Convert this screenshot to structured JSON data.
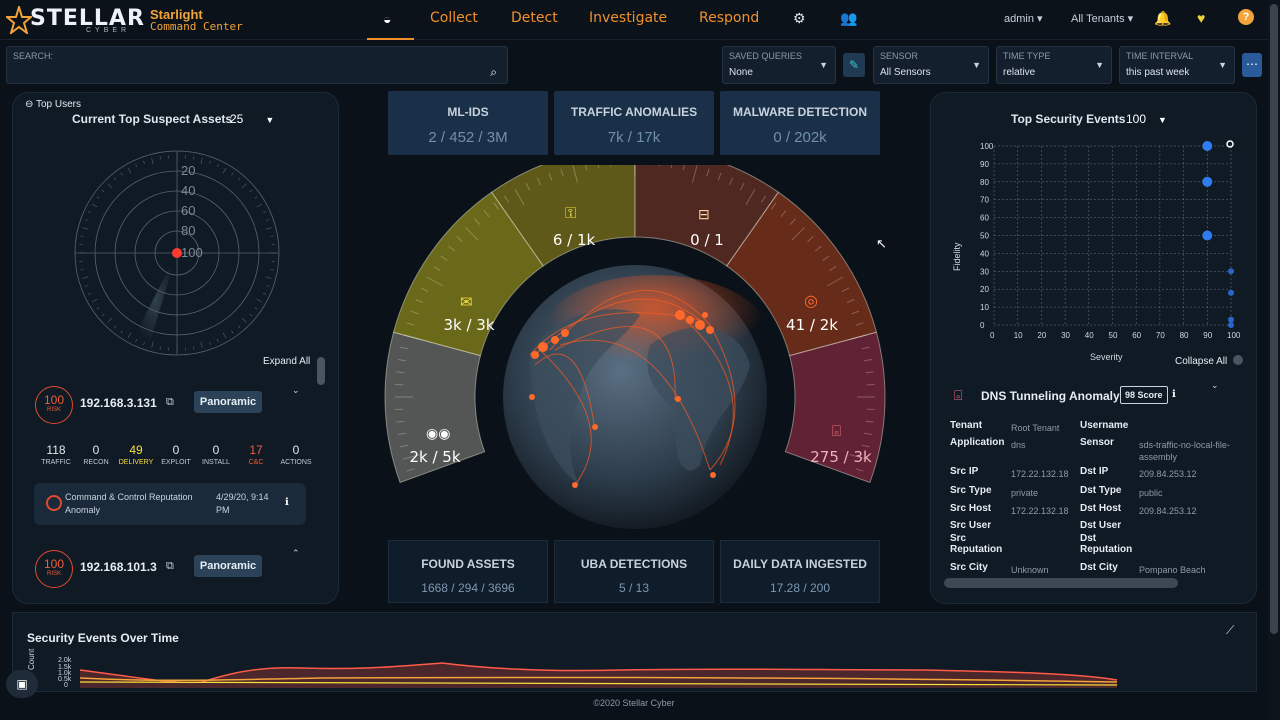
{
  "header": {
    "logo_word": "STELLAR",
    "logo_sub": "CYBER",
    "brand_line1": "Starlight",
    "brand_line2": "Command Center",
    "nav": [
      "Collect",
      "Detect",
      "Investigate",
      "Respond"
    ],
    "user": "admin ▾",
    "tenants": "All Tenants ▾"
  },
  "filters": {
    "search_label": "SEARCH:",
    "saved_queries": {
      "label": "SAVED QUERIES",
      "value": "None"
    },
    "sensor": {
      "label": "SENSOR",
      "value": "All Sensors"
    },
    "time_type": {
      "label": "TIME TYPE",
      "value": "relative"
    },
    "time_interval": {
      "label": "TIME INTERVAL",
      "value": "this past week"
    }
  },
  "left": {
    "top_users": "⊖ Top Users",
    "title": "Current Top Suspect Assets",
    "count": "25",
    "radar_labels": [
      "20",
      "40",
      "60",
      "80",
      "100"
    ],
    "expand_all": "Expand All",
    "assets": [
      {
        "risk": "100",
        "risk_label": "RISK",
        "ip": "192.168.3.131",
        "button": "Panoramic"
      },
      {
        "risk": "100",
        "risk_label": "RISK",
        "ip": "192.168.101.3",
        "button": "Panoramic"
      }
    ],
    "kill_chain": [
      {
        "n": "118",
        "l": "TRAFFIC"
      },
      {
        "n": "0",
        "l": "RECON"
      },
      {
        "n": "49",
        "l": "DELIVERY"
      },
      {
        "n": "0",
        "l": "EXPLOIT"
      },
      {
        "n": "0",
        "l": "INSTALL"
      },
      {
        "n": "17",
        "l": "C&C"
      },
      {
        "n": "0",
        "l": "ACTIONS"
      }
    ],
    "alert": {
      "text": "Command & Control Reputation Anomaly",
      "time": "4/29/20, 9:14 PM"
    }
  },
  "center": {
    "top_stats": [
      {
        "t": "ML-IDS",
        "v": "2 / 452 / 3M"
      },
      {
        "t": "TRAFFIC ANOMALIES",
        "v": "7k / 17k"
      },
      {
        "t": "MALWARE DETECTION",
        "v": "0 / 202k"
      }
    ],
    "gauge": [
      "2k / 5k",
      "3k / 3k",
      "6 / 1k",
      "0 / 1",
      "41 / 2k",
      "275 / 3k"
    ],
    "bottom_stats": [
      {
        "t": "FOUND ASSETS",
        "v": "1668 / 294 / 3696"
      },
      {
        "t": "UBA DETECTIONS",
        "v": "5 / 13"
      },
      {
        "t": "DAILY DATA INGESTED",
        "v": "17.28 / 200"
      }
    ]
  },
  "right": {
    "title": "Top Security Events",
    "count": "100",
    "y_label": "Fidelity",
    "x_label": "Severity",
    "collapse_all": "Collapse All",
    "event_title": "DNS Tunneling Anomaly",
    "score": "98 Score",
    "details": [
      {
        "k": "Tenant",
        "v": "Root Tenant",
        "k2": "Username",
        "v2": ""
      },
      {
        "k": "Application",
        "v": "dns",
        "k2": "Sensor",
        "v2": "sds-traffic-no-local-file-assembly"
      },
      {
        "k": "Src IP",
        "v": "172.22.132.18",
        "k2": "Dst IP",
        "v2": "209.84.253.12"
      },
      {
        "k": "Src Type",
        "v": "private",
        "k2": "Dst Type",
        "v2": "public"
      },
      {
        "k": "Src Host",
        "v": "172.22.132.18",
        "k2": "Dst Host",
        "v2": "209.84.253.12"
      },
      {
        "k": "Src User",
        "v": "",
        "k2": "Dst User",
        "v2": ""
      },
      {
        "k": "Src Reputation",
        "v": "",
        "k2": "Dst Reputation",
        "v2": ""
      },
      {
        "k": "Src City",
        "v": "Unknown",
        "k2": "Dst City",
        "v2": "Pompano Beach"
      }
    ]
  },
  "chart_data": {
    "type": "scatter",
    "title": "Top Security Events",
    "xlabel": "Severity",
    "ylabel": "Fidelity",
    "xlim": [
      0,
      100
    ],
    "ylim": [
      0,
      100
    ],
    "x_ticks": [
      0,
      10,
      20,
      30,
      40,
      50,
      60,
      70,
      80,
      90,
      100
    ],
    "y_ticks": [
      0,
      10,
      20,
      30,
      40,
      50,
      60,
      70,
      80,
      90,
      100
    ],
    "points": [
      {
        "x": 90,
        "y": 100
      },
      {
        "x": 90,
        "y": 80
      },
      {
        "x": 90,
        "y": 50
      },
      {
        "x": 100,
        "y": 30
      },
      {
        "x": 100,
        "y": 18
      },
      {
        "x": 100,
        "y": 3
      },
      {
        "x": 100,
        "y": 0
      }
    ]
  },
  "bottom": {
    "title": "Security Events Over Time",
    "y_label": "Count",
    "y_ticks": [
      "2.0k",
      "1.5k",
      "1.0k",
      "0.5k",
      "0"
    ]
  },
  "footer": "©2020 Stellar Cyber"
}
